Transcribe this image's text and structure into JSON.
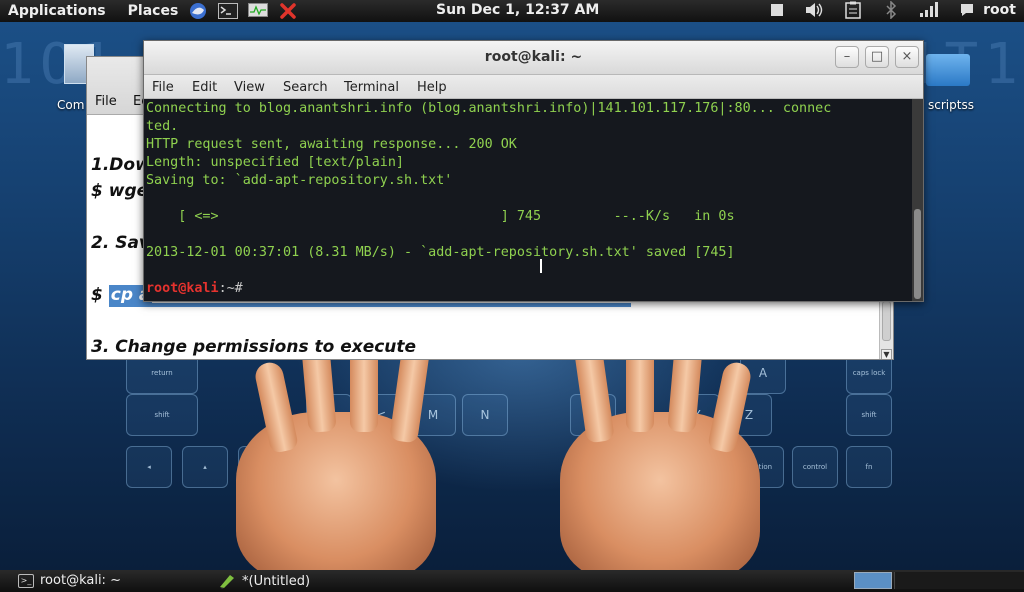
{
  "top_panel": {
    "applications": "Applications",
    "places": "Places",
    "clock": "Sun Dec  1, 12:37 AM",
    "user": "root",
    "launchers": [
      "iceweasel-icon",
      "terminal-icon",
      "system-monitor-icon",
      "close-x-icon"
    ],
    "tray_icons": [
      "stop-icon",
      "volume-icon",
      "clipboard-icon",
      "bluetooth-icon",
      "network-signal-icon",
      "chat-icon"
    ]
  },
  "desktop": {
    "icon_labels": [
      "Com",
      "scriptss"
    ]
  },
  "gedit": {
    "menu": {
      "file": "File",
      "edit": "Ec"
    },
    "lines": {
      "l1": "1.Dow",
      "l2": "$ wge",
      "l3": "2. Sav",
      "l4_prefix": "$ ",
      "l4_selected": "cp a",
      "l5": "3. Change permissions to execute"
    }
  },
  "terminal": {
    "title": "root@kali: ~",
    "buttons": {
      "minimize": "–",
      "maximize": "□",
      "close": "×"
    },
    "menu": [
      "File",
      "Edit",
      "View",
      "Search",
      "Terminal",
      "Help"
    ],
    "lines": [
      "Connecting to blog.anantshri.info (blog.anantshri.info)|141.101.117.176|:80... connec",
      "ted.",
      "HTTP request sent, awaiting response... 200 OK",
      "Length: unspecified [text/plain]",
      "Saving to: `add-apt-repository.sh.txt'",
      "",
      "    [ <=>                                   ] 745         --.-K/s   in 0s",
      "",
      "2013-12-01 00:37:01 (8.31 MB/s) - `add-apt-repository.sh.txt' saved [745]",
      ""
    ],
    "prompt": {
      "user": "root",
      "at": "@",
      "host": "kali",
      "rest": ":~#"
    }
  },
  "taskbar": {
    "tasks": [
      {
        "label": "root@kali: ~",
        "icon": "terminal-icon"
      },
      {
        "label": "*(Untitled)",
        "icon": "gedit-icon"
      }
    ]
  }
}
